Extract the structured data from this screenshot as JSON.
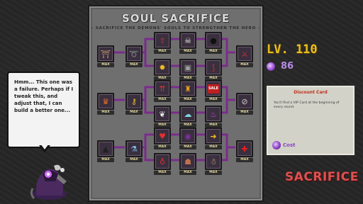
{
  "panel": {
    "title": "SOUL SACRIFICE",
    "subtitle": "- SACRIFICE THE DEMONS' SOULS TO STRENGTHEN THE HERO -"
  },
  "player": {
    "level_label": "LV. 110",
    "souls": "86"
  },
  "card": {
    "title": "Discount Card",
    "description": "You'll find a VIP Card at the beginning of every round.",
    "cost_label": "Cost"
  },
  "action": {
    "sacrifice_label": "SACRIFICE"
  },
  "dialog": {
    "text": "Hmm... This one was a failure. Perhaps if I tweak this, and adjust that, I can build a better one..."
  },
  "tree_nodes": [
    {
      "id": "n1",
      "icon": "shrine-icon",
      "glyph": "⛩",
      "color": "#c89a70",
      "tag": "MAX"
    },
    {
      "id": "n2",
      "icon": "whip-icon",
      "glyph": "➰",
      "color": "#c0c0c0",
      "tag": "MAX"
    },
    {
      "id": "n3",
      "icon": "upgrade-arrow-icon",
      "glyph": "⇧",
      "color": "#e03030",
      "tag": "MAX"
    },
    {
      "id": "n4",
      "icon": "skull-mage-icon",
      "glyph": "☠",
      "color": "#e8e8e8",
      "tag": "MAX"
    },
    {
      "id": "n5",
      "icon": "bomb-icon",
      "glyph": "●",
      "color": "#101010",
      "tag": "MAX"
    },
    {
      "id": "n6",
      "icon": "sun-gear-icon",
      "glyph": "✹",
      "color": "#f0c020",
      "tag": "MAX"
    },
    {
      "id": "n7",
      "icon": "chest-icon",
      "glyph": "▣",
      "color": "#a0a0a0",
      "tag": "MAX"
    },
    {
      "id": "n8",
      "icon": "claw-icon",
      "glyph": "⟆",
      "color": "#d03030",
      "tag": "MAX"
    },
    {
      "id": "n9",
      "icon": "crossed-swords-icon",
      "glyph": "⚔",
      "color": "#d03040",
      "tag": "MAX"
    },
    {
      "id": "n10",
      "icon": "demon-crown-icon",
      "glyph": "♛",
      "color": "#e07030",
      "tag": "MAX"
    },
    {
      "id": "n11",
      "icon": "key-icon",
      "glyph": "⚷",
      "color": "#e8c020",
      "tag": "MAX"
    },
    {
      "id": "n12",
      "icon": "double-arrow-icon",
      "glyph": "⇈",
      "color": "#e03030",
      "tag": "MAX"
    },
    {
      "id": "n13",
      "icon": "treasure-icon",
      "glyph": "♜",
      "color": "#e8a020",
      "tag": "MAX"
    },
    {
      "id": "n14",
      "icon": "sale-tag-icon",
      "glyph": "SALE",
      "color": "#ffffff",
      "tag": "MAX"
    },
    {
      "id": "n15",
      "icon": "no-entry-icon",
      "glyph": "⊘",
      "color": "#d0d0d0",
      "tag": "MAX"
    },
    {
      "id": "n16",
      "icon": "wings-icon",
      "glyph": "❦",
      "color": "#e8e8e8",
      "tag": "MAX"
    },
    {
      "id": "n17",
      "icon": "ghost-icon",
      "glyph": "☁",
      "color": "#80d8e0",
      "tag": "MAX"
    },
    {
      "id": "n18",
      "icon": "purple-flame-icon",
      "glyph": "♨",
      "color": "#c050e0",
      "tag": "MAX"
    },
    {
      "id": "n19",
      "icon": "top-hat-icon",
      "glyph": "▲",
      "color": "#202020",
      "tag": "MAX"
    },
    {
      "id": "n20",
      "icon": "potion-icon",
      "glyph": "⚗",
      "color": "#80c0f0",
      "tag": "MAX"
    },
    {
      "id": "n21",
      "icon": "heart-up-icon",
      "glyph": "♥",
      "color": "#e03030",
      "tag": "MAX"
    },
    {
      "id": "n22",
      "icon": "shadow-eyes-icon",
      "glyph": "◉",
      "color": "#8030a0",
      "tag": "MAX"
    },
    {
      "id": "n23",
      "icon": "arrow-right-icon",
      "glyph": "➜",
      "color": "#f0c020",
      "tag": "MAX"
    },
    {
      "id": "n24",
      "icon": "red-cross-icon",
      "glyph": "✚",
      "color": "#e02020",
      "tag": "MAX"
    },
    {
      "id": "n25",
      "icon": "red-potion-icon",
      "glyph": "♁",
      "color": "#e03030",
      "tag": "MAX"
    },
    {
      "id": "n26",
      "icon": "meat-icon",
      "glyph": "☗",
      "color": "#c07050",
      "tag": "MAX"
    },
    {
      "id": "n27",
      "icon": "flex-arm-icon",
      "glyph": "☃",
      "color": "#e8c090",
      "tag": "MAX"
    }
  ]
}
